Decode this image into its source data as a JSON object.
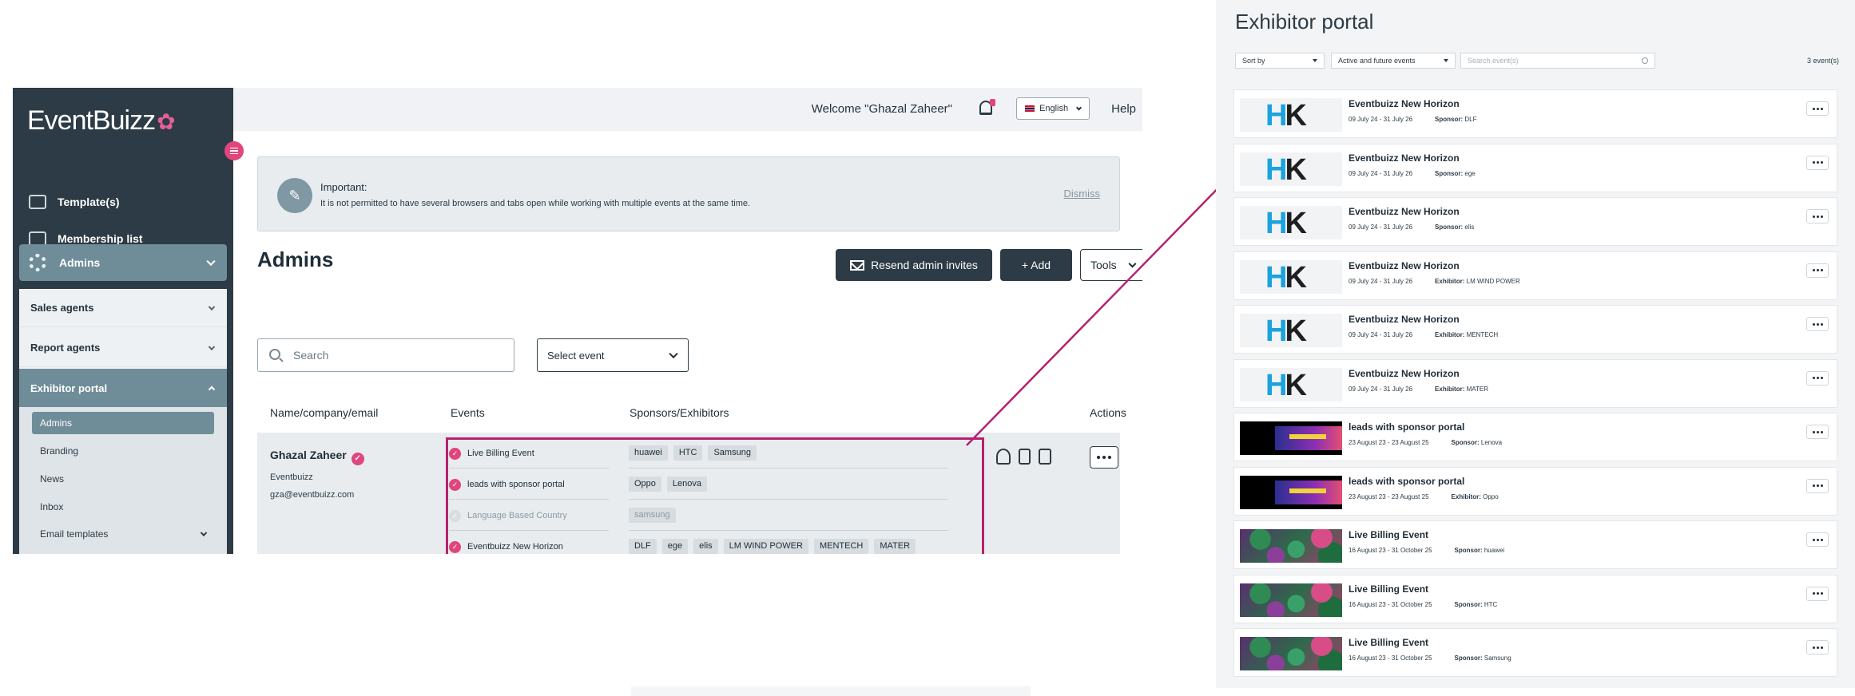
{
  "sidebar": {
    "logo": "EventBuizz",
    "links": [
      "Template(s)",
      "Membership list"
    ],
    "admins_label": "Admins",
    "submenu": [
      "Sales agents",
      "Report agents",
      "Exhibitor portal"
    ],
    "exhibitor_items": [
      "Admins",
      "Branding",
      "News",
      "Inbox",
      "Email templates"
    ],
    "menu_icon": "hamburger-icon"
  },
  "topbar": {
    "welcome": "Welcome \"Ghazal Zaheer\"",
    "language": "English",
    "help": "Help"
  },
  "notice": {
    "title": "Important:",
    "text": "It is not permitted to have several browsers and tabs open while working with multiple events at the same time.",
    "dismiss": "Dismiss"
  },
  "page": {
    "title": "Admins",
    "resend_button": "Resend admin invites",
    "add_button": "+ Add",
    "tools_button": "Tools",
    "search_placeholder": "Search",
    "select_event": "Select event"
  },
  "table": {
    "headers": [
      "Name/company/email",
      "Events",
      "Sponsors/Exhibitors",
      "Actions"
    ],
    "row": {
      "name": "Ghazal Zaheer",
      "company": "Eventbuizz",
      "email": "gza@eventbuizz.com",
      "events": [
        {
          "name": "Live Billing Event",
          "active": true,
          "sponsors": [
            "huawei",
            "HTC",
            "Samsung"
          ]
        },
        {
          "name": "leads with sponsor portal",
          "active": true,
          "sponsors": [
            "Oppo",
            "Lenova"
          ]
        },
        {
          "name": "Language Based Country",
          "active": false,
          "sponsors": [
            "samsung"
          ]
        },
        {
          "name": "Eventbuizz New Horizon",
          "active": true,
          "sponsors": [
            "DLF",
            "ege",
            "elis",
            "LM WIND POWER",
            "MENTECH",
            "MATER"
          ]
        }
      ]
    }
  },
  "portal": {
    "title": "Exhibitor portal",
    "sort_by": "Sort by",
    "filter": "Active and future events",
    "search_placeholder": "Search event(s)",
    "count": "3 event(s)",
    "cards": [
      {
        "title": "Eventbuizz New Horizon",
        "dates": "09 July 24 - 31 July 26",
        "role": "Sponsor:",
        "company": "DLF",
        "thumb": "hk"
      },
      {
        "title": "Eventbuizz New Horizon",
        "dates": "09 July 24 - 31 July 26",
        "role": "Sponsor:",
        "company": "ege",
        "thumb": "hk"
      },
      {
        "title": "Eventbuizz New Horizon",
        "dates": "09 July 24 - 31 July 26",
        "role": "Sponsor:",
        "company": "elis",
        "thumb": "hk"
      },
      {
        "title": "Eventbuizz New Horizon",
        "dates": "09 July 24 - 31 July 26",
        "role": "Exhibitor:",
        "company": "LM WIND POWER",
        "thumb": "hk"
      },
      {
        "title": "Eventbuizz New Horizon",
        "dates": "09 July 24 - 31 July 26",
        "role": "Exhibitor:",
        "company": "MENTECH",
        "thumb": "hk"
      },
      {
        "title": "Eventbuizz New Horizon",
        "dates": "09 July 24 - 31 July 26",
        "role": "Exhibitor:",
        "company": "MATER",
        "thumb": "hk"
      },
      {
        "title": "leads with sponsor portal",
        "dates": "23 August 23 - 23 August 25",
        "role": "Sponsor:",
        "company": "Lenova",
        "thumb": "lead"
      },
      {
        "title": "leads with sponsor portal",
        "dates": "23 August 23 - 23 August 25",
        "role": "Exhibitor:",
        "company": "Oppo",
        "thumb": "lead"
      },
      {
        "title": "Live Billing Event",
        "dates": "16 August 23 - 31 October 25",
        "role": "Sponsor:",
        "company": "huawei",
        "thumb": "live"
      },
      {
        "title": "Live Billing Event",
        "dates": "16 August 23 - 31 October 25",
        "role": "Sponsor:",
        "company": "HTC",
        "thumb": "live"
      },
      {
        "title": "Live Billing Event",
        "dates": "16 August 23 - 31 October 25",
        "role": "Sponsor:",
        "company": "Samsung",
        "thumb": "live"
      }
    ],
    "thumb_text": {
      "h": "H",
      "k": "K"
    }
  },
  "colors": {
    "sidebar": "#2c3b45",
    "accent": "#e0457b",
    "highlight": "#b5226f",
    "active_item": "#6f8d99"
  }
}
